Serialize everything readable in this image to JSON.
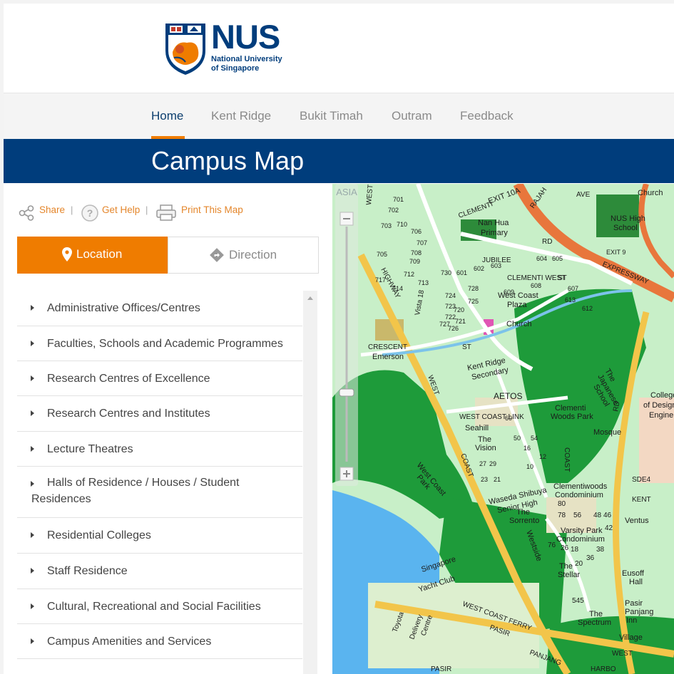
{
  "header": {
    "logo": {
      "name": "NUS",
      "line1": "National University",
      "line2": "of Singapore"
    }
  },
  "nav": {
    "items": [
      {
        "label": "Home",
        "active": true
      },
      {
        "label": "Kent Ridge"
      },
      {
        "label": "Bukit Timah"
      },
      {
        "label": "Outram"
      },
      {
        "label": "Feedback"
      }
    ]
  },
  "page_title": "Campus Map",
  "tools": {
    "share": "Share",
    "help": "Get Help",
    "print": "Print This Map",
    "separator": "|"
  },
  "tabs": {
    "location": "Location",
    "direction": "Direction"
  },
  "categories": [
    "Administrative Offices/Centres",
    "Faculties, Schools and Academic Programmes",
    "Research Centres of Excellence",
    "Research Centres and Institutes",
    "Lecture Theatres",
    "Halls of Residence / Houses / Student",
    "Residences",
    "Residential Colleges",
    "Staff Residence",
    "Cultural, Recreational and Social Facilities",
    "Campus Amenities and Services"
  ],
  "map": {
    "labels": {
      "expressway": "EXPRESSWAY",
      "exit": "EXIT 10A",
      "exit9": "EXIT 9",
      "clementi": "CLEMENTI",
      "nanhua": "Nan Hua",
      "primary": "Primary",
      "jubilee": "JUBILEE",
      "rd": "RD",
      "nushigh": "NUS High",
      "school": "School",
      "church": "Church",
      "westcoastplaza": "West Coast",
      "plaza": "Plaza",
      "clementiwest": "CLEMENTI WEST",
      "st": "ST",
      "westcoasthwy": "WEST COAST",
      "highway": "HIGHWAY",
      "vista": "Vista 18",
      "crescent": "CRESCENT",
      "emerson": "Emerson",
      "kentridge": "Kent Ridge",
      "secondary": "Secondary",
      "aetos": "AETOS",
      "westcoastlink": "WEST  COAST  LINK",
      "seahill": "Seahill",
      "thevision": "The",
      "vision": "Vision",
      "clementiwoods": "Clementi",
      "woodspark": "Woods Park",
      "mosque": "Mosque",
      "clementiwoodscondo": "Clementiwoods",
      "condominium": "Condominium",
      "westcoastpark": "West Coast",
      "park": "Park",
      "wasedashibuya": "Waseda Shibuya",
      "seniorhigh": "Senior High",
      "thesorrento": "The",
      "sorrento": "Sorrento",
      "varsitypark": "Varsity Park",
      "westside": "Westside",
      "thestellar": "The",
      "stellar": "Stellar",
      "singapore": "Singapore",
      "yachtclub": "Yacht Club",
      "toyota": "Toyota",
      "delivery": "Delivery",
      "centre": "Centre",
      "westcoastferry": "WEST COAST FERRY",
      "pasir": "PASIR",
      "panjang": "PANJANG",
      "pasirpanjang": "Pasir",
      "panjanginn": "Panjang",
      "inn": "Inn",
      "thespectrum": "The",
      "spectrum": "Spectrum",
      "village": "Village",
      "eusoff": "Eusoff",
      "hall": "Hall",
      "kent": "KENT",
      "ventus": "Ventus",
      "sde": "SDE4",
      "japanese": "The",
      "japschool": "Japanese",
      "school2": "School",
      "college": "College",
      "ofdesign": "of Design",
      "engine": "Engine",
      "west": "WEST",
      "coast": "COAST",
      "asia": "ASIA",
      "harbour": "HARBO",
      "rajah": "RAJAH",
      "ave": "AVE",
      "nos": [
        "601",
        "602",
        "603",
        "604",
        "605",
        "607",
        "608",
        "609",
        "612",
        "613",
        "701",
        "702",
        "703",
        "705",
        "706",
        "707",
        "708",
        "709",
        "710",
        "712",
        "713",
        "714",
        "717",
        "720",
        "721",
        "722",
        "723",
        "724",
        "725",
        "726",
        "727",
        "728",
        "730",
        "60",
        "50",
        "54",
        "16",
        "10",
        "12",
        "27",
        "29",
        "23",
        "21",
        "80",
        "78",
        "56",
        "48",
        "46",
        "42",
        "76",
        "26",
        "18",
        "38",
        "36",
        "20",
        "545"
      ]
    }
  },
  "colors": {
    "accent": "#ef7c00",
    "brand": "#003d7c",
    "link": "#e4862b"
  }
}
